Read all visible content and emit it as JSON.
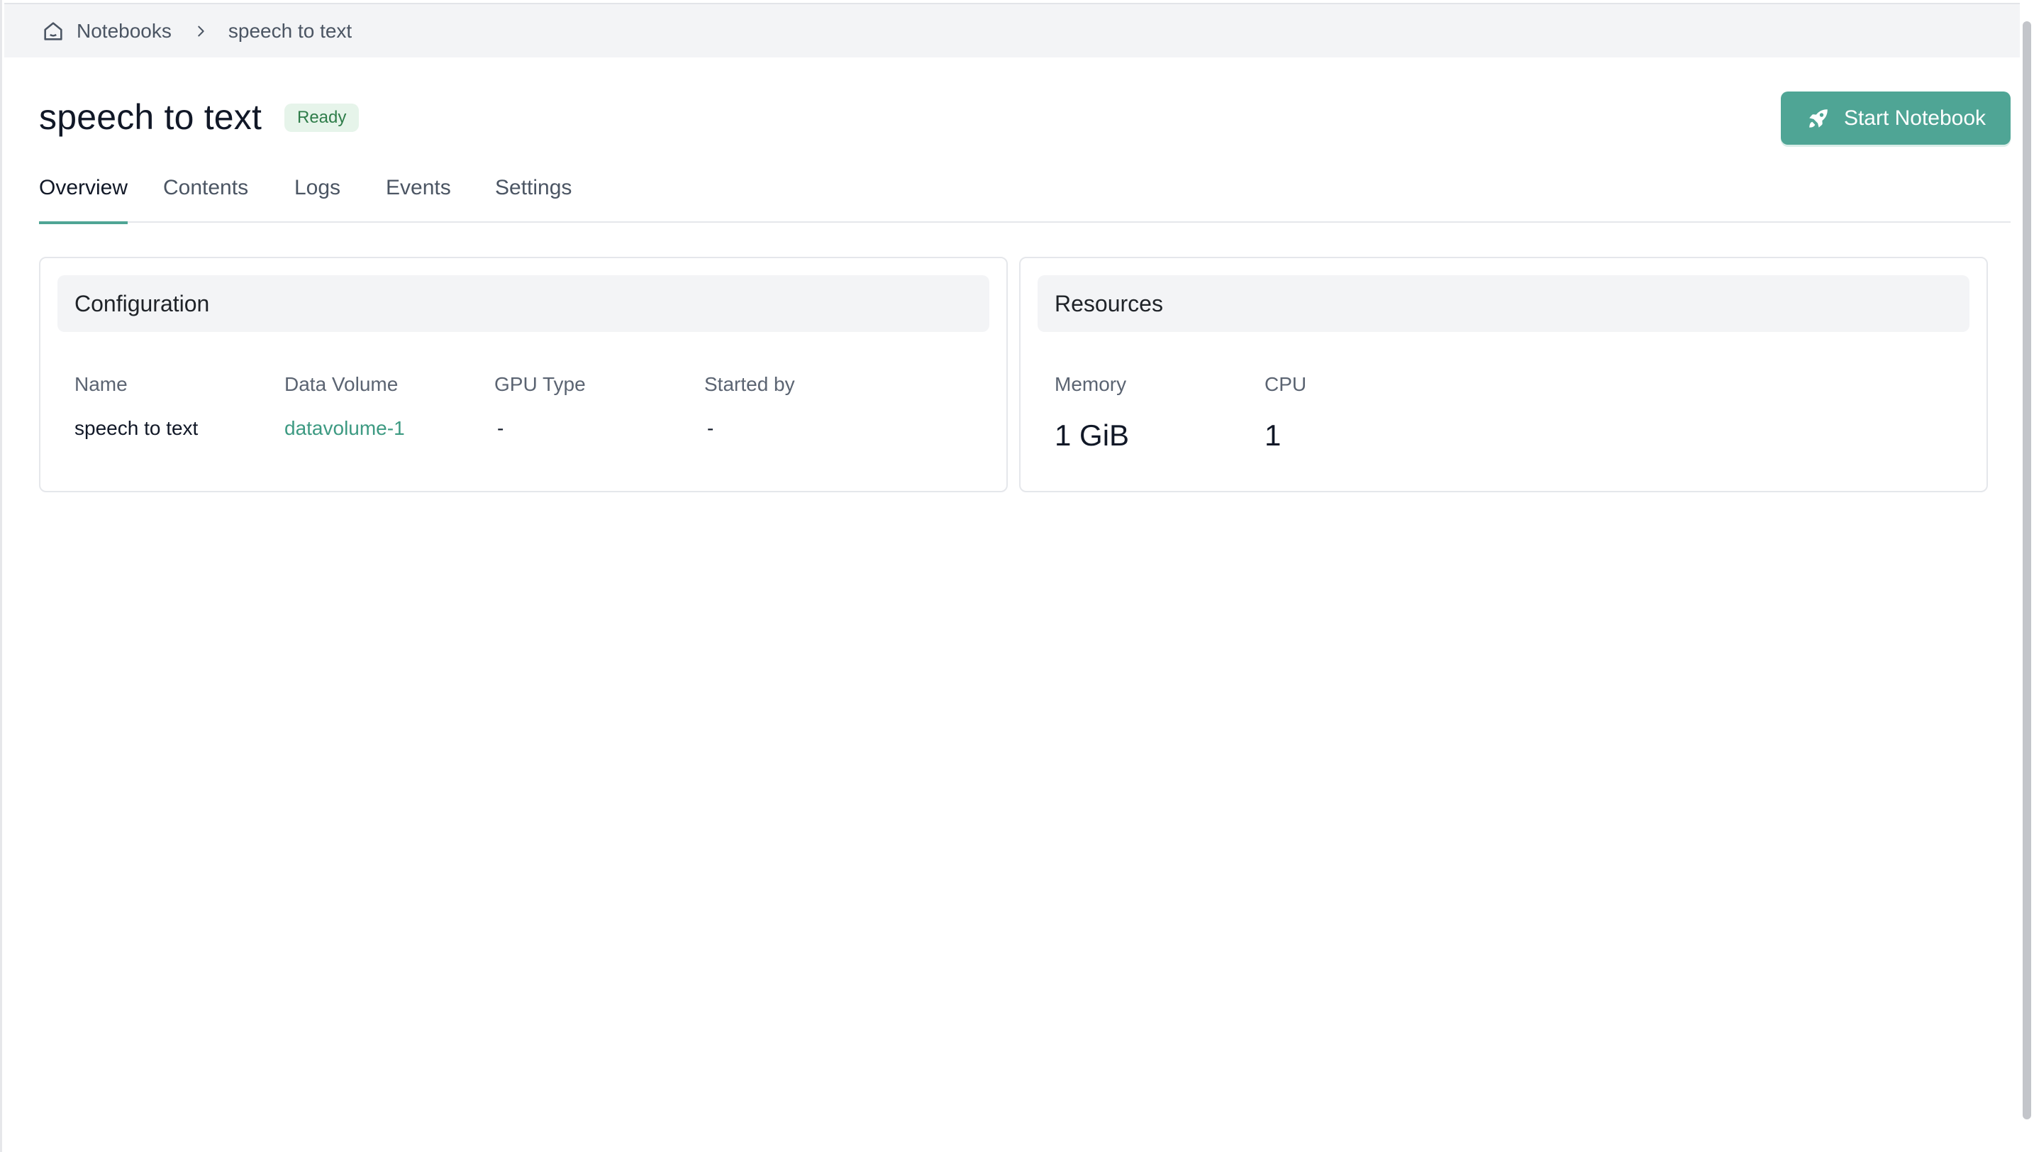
{
  "breadcrumb": {
    "home_label": "Notebooks",
    "current": "speech to text"
  },
  "header": {
    "title": "speech to text",
    "status": "Ready",
    "start_button": "Start Notebook"
  },
  "tabs": [
    {
      "label": "Overview",
      "active": true
    },
    {
      "label": "Contents",
      "active": false
    },
    {
      "label": "Logs",
      "active": false
    },
    {
      "label": "Events",
      "active": false
    },
    {
      "label": "Settings",
      "active": false
    }
  ],
  "configuration": {
    "title": "Configuration",
    "fields": [
      {
        "label": "Name",
        "value": "speech to text"
      },
      {
        "label": "Data Volume",
        "value": "datavolume-1"
      },
      {
        "label": "GPU Type",
        "value": "-"
      },
      {
        "label": "Started by",
        "value": "-"
      }
    ]
  },
  "resources": {
    "title": "Resources",
    "fields": [
      {
        "label": "Memory",
        "value": "1 GiB"
      },
      {
        "label": "CPU",
        "value": "1"
      }
    ]
  },
  "colors": {
    "accent": "#4fa595",
    "link": "#3d9a82",
    "badge_bg": "#e6f4ea",
    "badge_text": "#2f7d4a"
  },
  "icons": {
    "home": "home-icon",
    "separator": "chevron-right-icon",
    "start": "rocket-icon"
  }
}
